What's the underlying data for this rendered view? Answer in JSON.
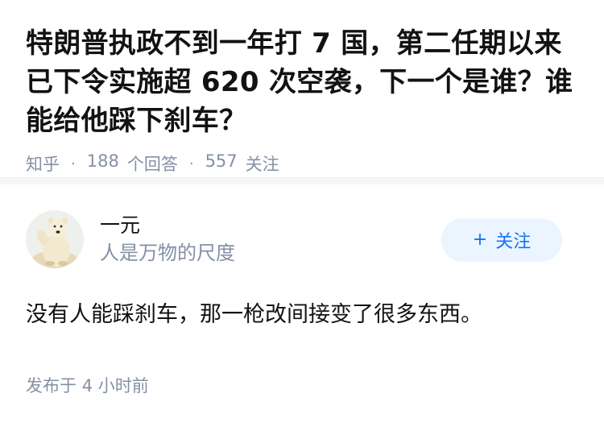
{
  "question": {
    "title": "特朗普执政不到一年打 7 国，第二任期以来已下令实施超 620 次空袭，下一个是谁？谁能给他踩下刹车？",
    "source": "知乎",
    "answer_count": "188",
    "answer_label": "个回答",
    "follower_count": "557",
    "follower_label": "关注"
  },
  "answer": {
    "author_name": "一元",
    "author_bio": "人是万物的尺度",
    "follow_label": "关注",
    "content": "没有人能踩刹车，那一枪改间接变了很多东西。",
    "time_prefix": "发布于",
    "time_value": "4 小时前"
  },
  "colors": {
    "accent": "#1772f6",
    "follow_bg": "#ebf5ff",
    "meta_gray": "#8590a6"
  },
  "icons": {
    "follow": "plus-icon",
    "avatar": "polar-bear-avatar"
  }
}
